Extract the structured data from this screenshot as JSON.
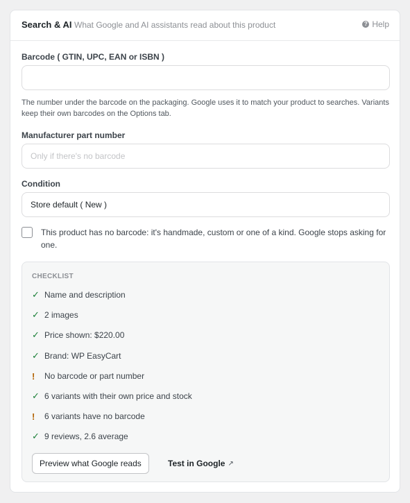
{
  "panel": {
    "title": "Search & AI",
    "subtitle": "What Google and AI assistants read about this product",
    "help_label": "Help",
    "help_icon": "question-circle-icon"
  },
  "barcode": {
    "label": "Barcode ( GTIN, UPC, EAN or ISBN )",
    "value": "",
    "placeholder": "",
    "help": "The number under the barcode on the packaging. Google uses it to match your product to searches. Variants keep their own barcodes on the Options tab."
  },
  "mpn": {
    "label": "Manufacturer part number",
    "value": "",
    "placeholder": "Only if there's no barcode"
  },
  "condition": {
    "label": "Condition",
    "selected": "Store default ( New )"
  },
  "no_barcode": {
    "checked": false,
    "label": "This product has no barcode: it's handmade, custom or one of a kind. Google stops asking for one."
  },
  "checklist": {
    "title": "CHECKLIST",
    "items": [
      {
        "status": "ok",
        "icon": "✓",
        "text": "Name and description"
      },
      {
        "status": "ok",
        "icon": "✓",
        "text": "2 images"
      },
      {
        "status": "ok",
        "icon": "✓",
        "text": "Price shown: $220.00"
      },
      {
        "status": "ok",
        "icon": "✓",
        "text": "Brand: WP EasyCart"
      },
      {
        "status": "warn",
        "icon": "!",
        "text": "No barcode or part number"
      },
      {
        "status": "ok",
        "icon": "✓",
        "text": "6 variants with their own price and stock"
      },
      {
        "status": "warn",
        "icon": "!",
        "text": "6 variants have no barcode"
      },
      {
        "status": "ok",
        "icon": "✓",
        "text": "9 reviews, 2.6 average"
      }
    ],
    "preview_button": "Preview what Google reads",
    "test_link": "Test in Google",
    "test_link_icon": "↗"
  },
  "colors": {
    "ok": "#1a7f37",
    "warn": "#b26200",
    "border": "#dcdcde"
  }
}
